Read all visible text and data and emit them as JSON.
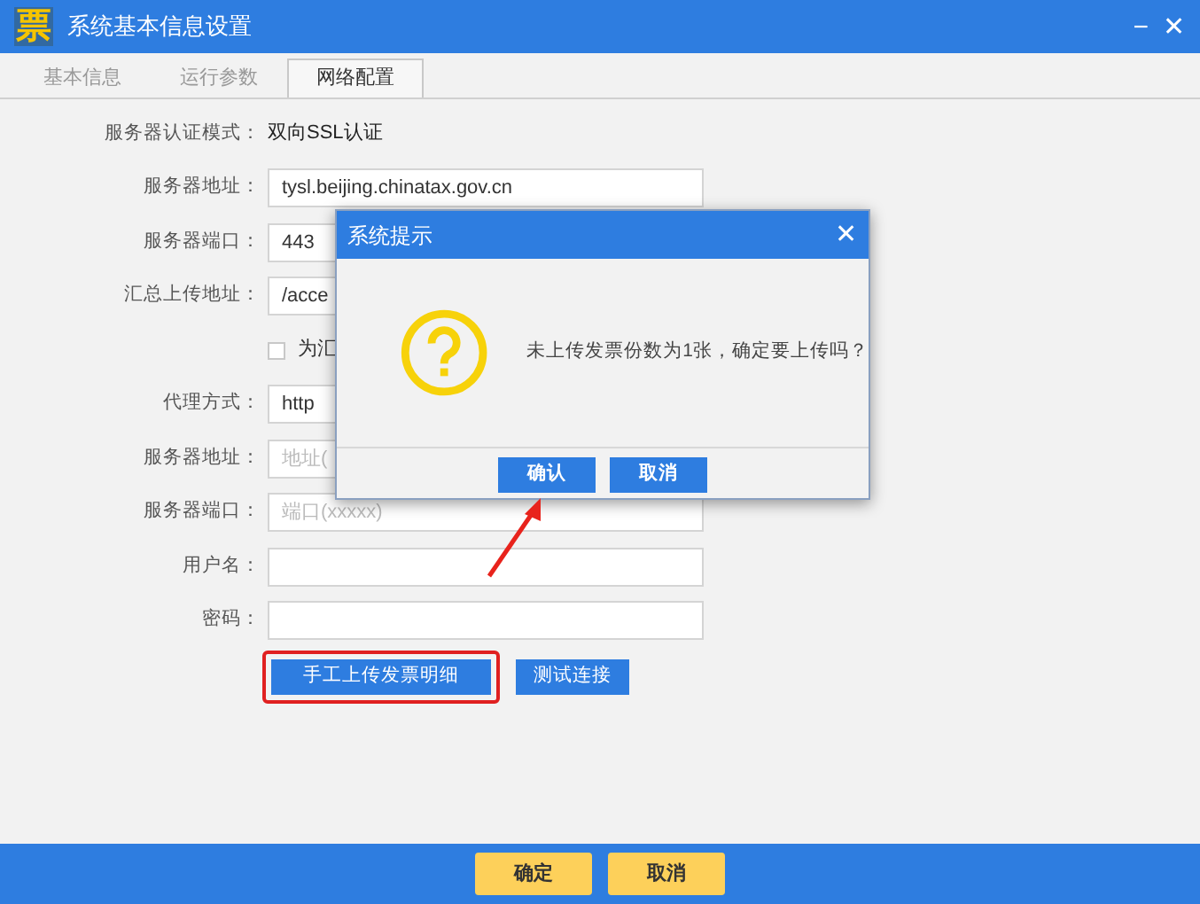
{
  "window": {
    "logo": "票",
    "title": "系统基本信息设置",
    "controls": [
      "−",
      "✕"
    ]
  },
  "tabs": [
    {
      "label": "基本信息",
      "selected": false
    },
    {
      "label": "运行参数",
      "selected": false
    },
    {
      "label": "网络配置",
      "selected": true
    }
  ],
  "form": [
    {
      "kind": "text",
      "label": "服务器认证模式：",
      "value": "双向SSL认证"
    },
    {
      "kind": "field",
      "label": "服务器地址：",
      "value": "tysl.beijing.chinatax.gov.cn"
    },
    {
      "kind": "field",
      "label": "服务器端口：",
      "value": "443"
    },
    {
      "kind": "field",
      "label": "汇总上传地址：",
      "value": "/acce"
    },
    {
      "kind": "checkbox",
      "label": "为汇",
      "checked": false
    },
    {
      "kind": "field",
      "label": "代理方式：",
      "value": "http"
    },
    {
      "kind": "field",
      "label": "服务器地址：",
      "placeholder": "地址("
    },
    {
      "kind": "field",
      "label": "服务器端口：",
      "placeholder": "端口(xxxxx)"
    },
    {
      "kind": "field",
      "label": "用户名："
    },
    {
      "kind": "field",
      "label": "密码："
    }
  ],
  "actions": [
    {
      "label": "手工上传发票明细",
      "highlighted": true
    },
    {
      "label": "测试连接",
      "highlighted": false
    }
  ],
  "dialog": {
    "title": "系统提示",
    "close": "✕",
    "message": "未上传发票份数为1张，确定要上传吗？",
    "buttons": [
      "确认",
      "取消"
    ]
  },
  "footer_buttons": [
    "确定",
    "取消"
  ]
}
